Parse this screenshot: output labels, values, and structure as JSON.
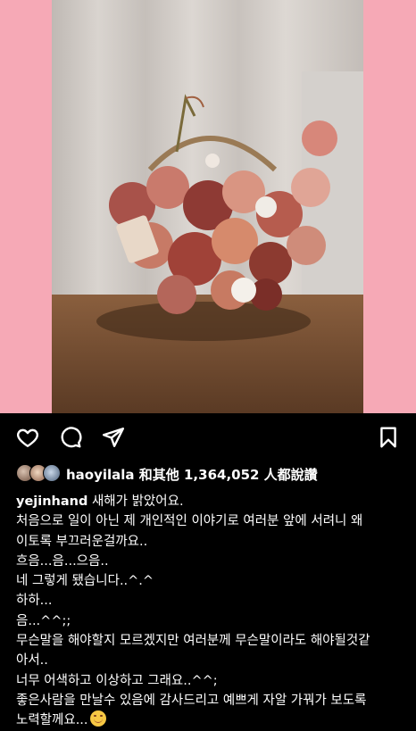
{
  "post": {
    "image_alt_icon": "flower-basket-photo",
    "frame_color": "#f6a9b6"
  },
  "actions": {
    "like_icon": "heart-icon",
    "comment_icon": "comment-icon",
    "share_icon": "send-icon",
    "save_icon": "bookmark-icon"
  },
  "likes": {
    "text": "haoyilala 和其他 1,364,052 人都說讚"
  },
  "caption": {
    "username": "yejinhand",
    "first_line": " 새해가 밝았어요.",
    "lines": [
      "처음으로 일이 아닌 제 개인적인 이야기로 여러분 앞에 서려니 왜",
      "이토록 부끄러운걸까요..",
      "흐음...음...으음..",
      "네 그렇게 됐습니다..^.^",
      "하하...",
      "음...^^;;",
      "무슨말을 해야할지 모르겠지만 여러분께 무슨말이라도 해야될것같",
      "아서..",
      "너무 어색하고 이상하고 그래요..^^;",
      "좋은사람을 만날수 있음에 감사드리고 예쁘게 자알 가꿔가 보도록",
      "노력할께요..."
    ],
    "trailing_emoji": "smiling-face-emoji"
  }
}
